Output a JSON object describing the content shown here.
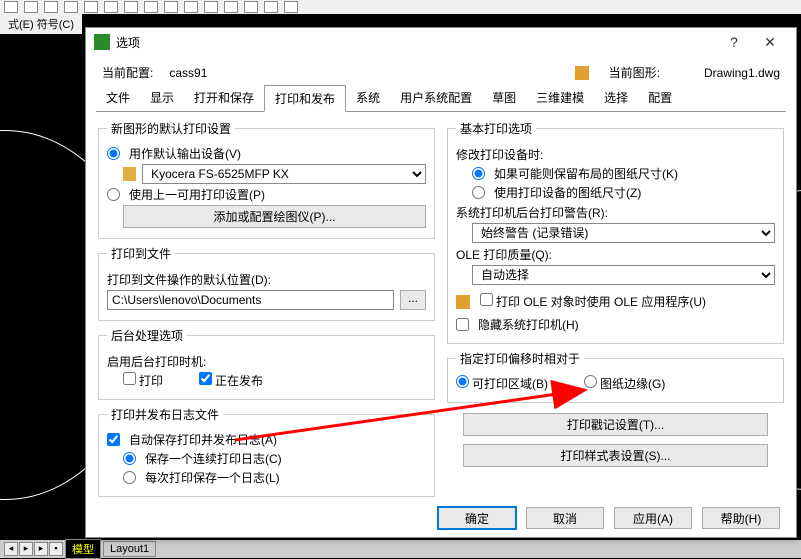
{
  "bg": {
    "menubar": "式(E)  符号(C)",
    "tab_model": "模型",
    "tab_layout": "Layout1"
  },
  "dialog": {
    "title": "选项",
    "profile_label": "当前配置:",
    "profile_value": "cass91",
    "drawing_label": "当前图形:",
    "drawing_value": "Drawing1.dwg",
    "tabs": [
      "文件",
      "显示",
      "打开和保存",
      "打印和发布",
      "系统",
      "用户系统配置",
      "草图",
      "三维建模",
      "选择",
      "配置"
    ],
    "left": {
      "fs_new": {
        "legend": "新图形的默认打印设置",
        "opt_default": "用作默认输出设备(V)",
        "device": "Kyocera FS-6525MFP KX",
        "opt_last": "使用上一可用打印设置(P)",
        "btn_config": "添加或配置绘图仪(P)..."
      },
      "fs_file": {
        "legend": "打印到文件",
        "label": "打印到文件操作的默认位置(D):",
        "path": "C:\\Users\\lenovo\\Documents"
      },
      "fs_bg": {
        "legend": "后台处理选项",
        "label": "启用后台打印时机:",
        "chk_print": "打印",
        "chk_publish": "正在发布"
      },
      "fs_log": {
        "legend": "打印并发布日志文件",
        "chk_auto": "自动保存打印并发布日志(A)",
        "opt_single": "保存一个连续打印日志(C)",
        "opt_each": "每次打印保存一个日志(L)"
      }
    },
    "right": {
      "fs_basic": {
        "legend": "基本打印选项",
        "label1": "修改打印设备时:",
        "opt_keep": "如果可能则保留布局的图纸尺寸(K)",
        "opt_use": "使用打印设备的图纸尺寸(Z)",
        "label2": "系统打印机后台打印警告(R):",
        "sel_warn": "始终警告 (记录错误)",
        "label3": "OLE 打印质量(Q):",
        "sel_ole": "自动选择",
        "chk_ole": "打印 OLE 对象时使用 OLE 应用程序(U)",
        "chk_hide": "隐藏系统打印机(H)"
      },
      "fs_offset": {
        "legend": "指定打印偏移时相对于",
        "opt_area": "可打印区域(B)",
        "opt_edge": "图纸边缘(G)"
      },
      "btn_stamp": "打印戳记设置(T)...",
      "btn_styles": "打印样式表设置(S)..."
    },
    "buttons": {
      "ok": "确定",
      "cancel": "取消",
      "apply": "应用(A)",
      "help": "帮助(H)"
    }
  }
}
